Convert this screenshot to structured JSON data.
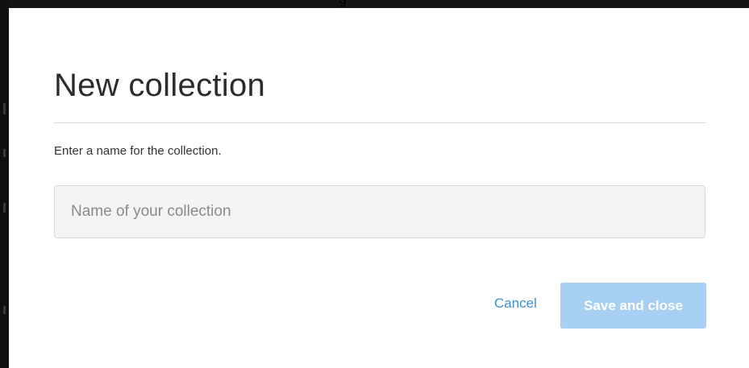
{
  "dialog": {
    "title": "New collection",
    "instruction": "Enter a name for the collection.",
    "name_input": {
      "value": "",
      "placeholder": "Name of your collection"
    },
    "cancel_label": "Cancel",
    "save_label": "Save and close",
    "save_enabled": false
  },
  "background": {
    "partial_text": "g"
  },
  "colors": {
    "link": "#3a8fd6",
    "primary_disabled": "#a8d0f2",
    "input_bg": "#f4f4f4",
    "title_text": "#2c2c2c",
    "backdrop": "#101010"
  }
}
